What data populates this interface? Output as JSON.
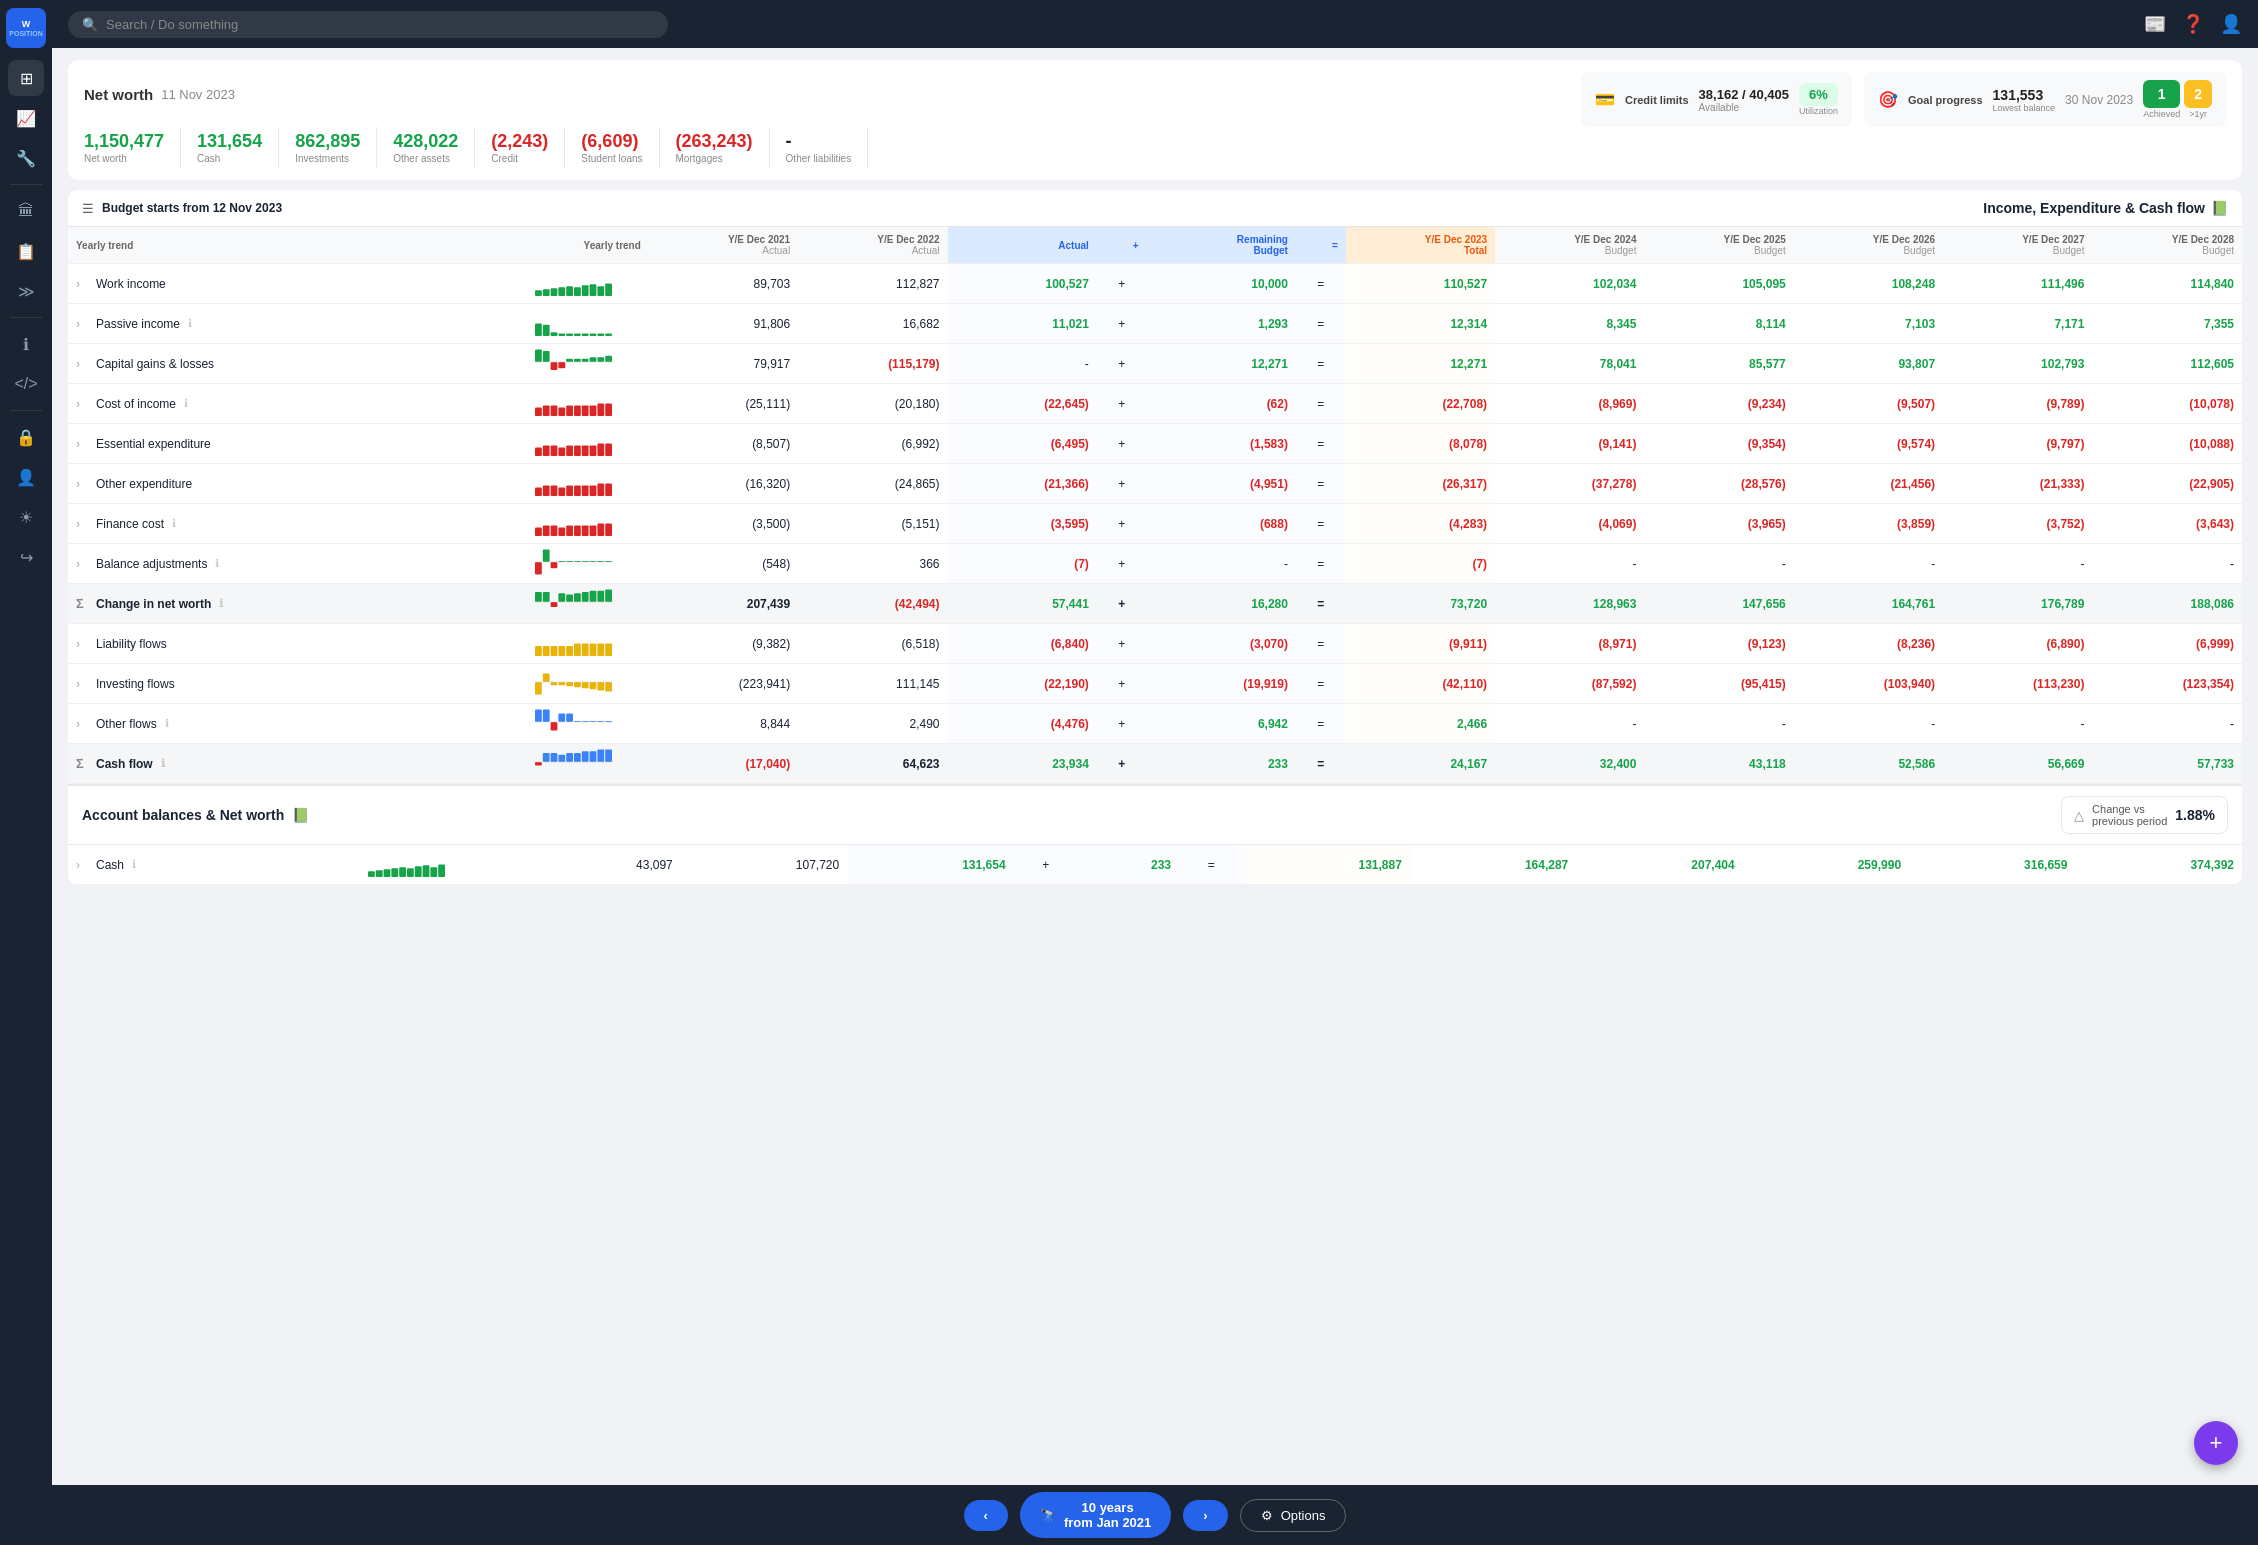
{
  "app": {
    "name": "Wealth Position",
    "search_placeholder": "Search / Do something"
  },
  "sidebar": {
    "items": [
      {
        "id": "dashboard",
        "icon": "⊞",
        "label": "Dashboard"
      },
      {
        "id": "trend",
        "icon": "📈",
        "label": "Trend"
      },
      {
        "id": "tools",
        "icon": "🔧",
        "label": "Tools"
      },
      {
        "id": "bank",
        "icon": "🏦",
        "label": "Bank"
      },
      {
        "id": "reports",
        "icon": "📋",
        "label": "Reports"
      },
      {
        "id": "expand",
        "icon": "≫",
        "label": "Expand"
      },
      {
        "id": "info",
        "icon": "ℹ",
        "label": "Info"
      },
      {
        "id": "code",
        "icon": "</>",
        "label": "Code"
      },
      {
        "id": "lock",
        "icon": "🔒",
        "label": "Lock"
      },
      {
        "id": "person",
        "icon": "👤",
        "label": "Person"
      },
      {
        "id": "settings",
        "icon": "☀",
        "label": "Settings"
      },
      {
        "id": "logout",
        "icon": "↪",
        "label": "Logout"
      }
    ]
  },
  "networth": {
    "title": "Net worth",
    "date": "11 Nov 2023",
    "metrics": [
      {
        "label": "Net worth",
        "value": "1,150,477",
        "color": "green"
      },
      {
        "label": "Cash",
        "value": "131,654",
        "color": "green"
      },
      {
        "label": "Investments",
        "value": "862,895",
        "color": "green"
      },
      {
        "label": "Other assets",
        "value": "428,022",
        "color": "green"
      },
      {
        "label": "Credit",
        "value": "(2,243)",
        "color": "red"
      },
      {
        "label": "Student loans",
        "value": "(6,609)",
        "color": "red"
      },
      {
        "label": "Mortgages",
        "value": "(263,243)",
        "color": "red"
      },
      {
        "label": "Other liabilities",
        "value": "-",
        "color": "dark"
      }
    ]
  },
  "credit": {
    "title": "Credit limits",
    "icon": "💳",
    "amount": "38,162 / 40,405",
    "available_label": "Available",
    "utilization": "6%",
    "util_label": "Utilization"
  },
  "goal": {
    "title": "Goal progress",
    "icon": "🎯",
    "balance": "131,553",
    "balance_label": "Lowest balance",
    "date": "30 Nov 2023",
    "achieved": "1",
    "achieved_label": "Achieved",
    "gt1yr": "2",
    "gt1yr_label": ">1yr"
  },
  "budget": {
    "header": "Budget starts from 12 Nov 2023",
    "period_label": "Yearly trend",
    "columns": [
      {
        "id": "trend",
        "label": "Yearly trend",
        "sub": ""
      },
      {
        "id": "y2021",
        "label": "Y/E Dec 2021",
        "sub": "Actual"
      },
      {
        "id": "y2022",
        "label": "Y/E Dec 2022",
        "sub": "Actual"
      },
      {
        "id": "actual",
        "label": "Actual",
        "sub": "",
        "highlight": "blue"
      },
      {
        "id": "plus",
        "label": "+",
        "sub": ""
      },
      {
        "id": "remaining",
        "label": "Remaining",
        "sub": "Budget"
      },
      {
        "id": "eq",
        "label": "=",
        "sub": ""
      },
      {
        "id": "y2023",
        "label": "Y/E Dec 2023",
        "sub": "Total",
        "highlight": "orange"
      },
      {
        "id": "y2024",
        "label": "Y/E Dec 2024",
        "sub": "Budget"
      },
      {
        "id": "y2025",
        "label": "Y/E Dec 2025",
        "sub": "Budget"
      },
      {
        "id": "y2026",
        "label": "Y/E Dec 2026",
        "sub": "Budget"
      },
      {
        "id": "y2027",
        "label": "Y/E Dec 2027",
        "sub": "Budget"
      },
      {
        "id": "y2028",
        "label": "Y/E Dec 2028",
        "sub": "Budget"
      }
    ],
    "section1": {
      "title": "Income, Expenditure & Cash flow",
      "rows": [
        {
          "id": "work-income",
          "label": "Work income",
          "type": "expandable",
          "has_info": false,
          "chart": "green-bars",
          "y2021": "89,703",
          "y2022": "112,827",
          "actual": "100,527",
          "plus": "+",
          "remaining": "10,000",
          "eq": "=",
          "y2023": "110,527",
          "y2024": "102,034",
          "y2025": "105,095",
          "y2026": "108,248",
          "y2027": "111,496",
          "y2028": "114,840",
          "actual_color": "green",
          "y2023_color": "green"
        },
        {
          "id": "passive-income",
          "label": "Passive income",
          "type": "expandable",
          "has_info": true,
          "chart": "green-small",
          "y2021": "91,806",
          "y2022": "16,682",
          "actual": "11,021",
          "plus": "+",
          "remaining": "1,293",
          "eq": "=",
          "y2023": "12,314",
          "y2024": "8,345",
          "y2025": "8,114",
          "y2026": "7,103",
          "y2027": "7,171",
          "y2028": "7,355",
          "actual_color": "green",
          "y2023_color": "green"
        },
        {
          "id": "capital-gains",
          "label": "Capital gains & losses",
          "type": "expandable",
          "has_info": false,
          "chart": "mixed",
          "y2021": "79,917",
          "y2022": "(115,179)",
          "actual": "-",
          "plus": "+",
          "remaining": "12,271",
          "eq": "=",
          "y2023": "12,271",
          "y2024": "78,041",
          "y2025": "85,577",
          "y2026": "93,807",
          "y2027": "102,793",
          "y2028": "112,605",
          "actual_color": "dark",
          "y2023_color": "green",
          "y2022_color": "red"
        },
        {
          "id": "cost-of-income",
          "label": "Cost of income",
          "type": "expandable",
          "has_info": true,
          "chart": "red-bars",
          "y2021": "(25,111)",
          "y2022": "(20,180)",
          "actual": "(22,645)",
          "plus": "+",
          "remaining": "(62)",
          "eq": "=",
          "y2023": "(22,708)",
          "y2024": "(8,969)",
          "y2025": "(9,234)",
          "y2026": "(9,507)",
          "y2027": "(9,789)",
          "y2028": "(10,078)",
          "actual_color": "red",
          "y2023_color": "red"
        },
        {
          "id": "essential-expenditure",
          "label": "Essential expenditure",
          "type": "expandable",
          "has_info": false,
          "chart": "red-bars",
          "y2021": "(8,507)",
          "y2022": "(6,992)",
          "actual": "(6,495)",
          "plus": "+",
          "remaining": "(1,583)",
          "eq": "=",
          "y2023": "(8,078)",
          "y2024": "(9,141)",
          "y2025": "(9,354)",
          "y2026": "(9,574)",
          "y2027": "(9,797)",
          "y2028": "(10,088)",
          "actual_color": "red",
          "y2023_color": "red"
        },
        {
          "id": "other-expenditure",
          "label": "Other expenditure",
          "type": "expandable",
          "has_info": false,
          "chart": "red-bars",
          "y2021": "(16,320)",
          "y2022": "(24,865)",
          "actual": "(21,366)",
          "plus": "+",
          "remaining": "(4,951)",
          "eq": "=",
          "y2023": "(26,317)",
          "y2024": "(37,278)",
          "y2025": "(28,576)",
          "y2026": "(21,456)",
          "y2027": "(21,333)",
          "y2028": "(22,905)",
          "actual_color": "red",
          "y2023_color": "red"
        },
        {
          "id": "finance-cost",
          "label": "Finance cost",
          "type": "expandable",
          "has_info": true,
          "chart": "red-bars",
          "y2021": "(3,500)",
          "y2022": "(5,151)",
          "actual": "(3,595)",
          "plus": "+",
          "remaining": "(688)",
          "eq": "=",
          "y2023": "(4,283)",
          "y2024": "(4,069)",
          "y2025": "(3,965)",
          "y2026": "(3,859)",
          "y2027": "(3,752)",
          "y2028": "(3,643)",
          "actual_color": "red",
          "y2023_color": "red"
        },
        {
          "id": "balance-adjustments",
          "label": "Balance adjustments",
          "type": "expandable",
          "has_info": true,
          "chart": "tiny-mixed",
          "y2021": "(548)",
          "y2022": "366",
          "actual": "(7)",
          "plus": "+",
          "remaining": "-",
          "eq": "=",
          "y2023": "(7)",
          "y2024": "-",
          "y2025": "-",
          "y2026": "-",
          "y2027": "-",
          "y2028": "-",
          "actual_color": "red",
          "y2023_color": "red"
        },
        {
          "id": "change-in-net-worth",
          "label": "Change in net worth",
          "type": "sigma",
          "has_info": true,
          "chart": "green-bars-tall",
          "y2021": "207,439",
          "y2022": "(42,494)",
          "actual": "57,441",
          "plus": "+",
          "remaining": "16,280",
          "eq": "=",
          "y2023": "73,720",
          "y2024": "128,963",
          "y2025": "147,656",
          "y2026": "164,761",
          "y2027": "176,789",
          "y2028": "188,086",
          "actual_color": "green",
          "y2022_color": "red",
          "y2023_color": "green",
          "is_sum": true
        },
        {
          "id": "liability-flows",
          "label": "Liability flows",
          "type": "expandable",
          "has_info": false,
          "chart": "yellow-bars",
          "y2021": "(9,382)",
          "y2022": "(6,518)",
          "actual": "(6,840)",
          "plus": "+",
          "remaining": "(3,070)",
          "eq": "=",
          "y2023": "(9,911)",
          "y2024": "(8,971)",
          "y2025": "(9,123)",
          "y2026": "(8,236)",
          "y2027": "(6,890)",
          "y2028": "(6,999)",
          "actual_color": "red",
          "y2023_color": "red"
        },
        {
          "id": "investing-flows",
          "label": "Investing flows",
          "type": "expandable",
          "has_info": false,
          "chart": "yellow-mixed",
          "y2021": "(223,941)",
          "y2022": "111,145",
          "actual": "(22,190)",
          "plus": "+",
          "remaining": "(19,919)",
          "eq": "=",
          "y2023": "(42,110)",
          "y2024": "(87,592)",
          "y2025": "(95,415)",
          "y2026": "(103,940)",
          "y2027": "(113,230)",
          "y2028": "(123,354)",
          "actual_color": "red",
          "y2023_color": "red"
        },
        {
          "id": "other-flows",
          "label": "Other flows",
          "type": "expandable",
          "has_info": true,
          "chart": "blue-bars",
          "y2021": "8,844",
          "y2022": "2,490",
          "actual": "(4,476)",
          "plus": "+",
          "remaining": "6,942",
          "eq": "=",
          "y2023": "2,466",
          "y2024": "-",
          "y2025": "-",
          "y2026": "-",
          "y2027": "-",
          "y2028": "-",
          "actual_color": "red",
          "y2023_color": "green"
        },
        {
          "id": "cash-flow",
          "label": "Cash flow",
          "type": "sigma",
          "has_info": true,
          "chart": "blue-mixed",
          "y2021": "(17,040)",
          "y2022": "64,623",
          "actual": "23,934",
          "plus": "+",
          "remaining": "233",
          "eq": "=",
          "y2023": "24,167",
          "y2024": "32,400",
          "y2025": "43,118",
          "y2026": "52,586",
          "y2027": "56,669",
          "y2028": "57,733",
          "actual_color": "green",
          "y2021_color": "red",
          "y2023_color": "green",
          "is_sum": true
        }
      ]
    },
    "section2": {
      "title": "Account balances & Net worth",
      "rows": [
        {
          "id": "cash",
          "label": "Cash",
          "type": "expandable",
          "has_info": true,
          "chart": "green-bars",
          "y2021": "43,097",
          "y2022": "107,720",
          "actual": "131,654",
          "plus": "+",
          "remaining": "233",
          "eq": "=",
          "y2023": "131,887",
          "y2024": "164,287",
          "y2025": "207,404",
          "y2026": "259,990",
          "y2027": "316,659",
          "y2028": "374,392",
          "actual_color": "green",
          "y2023_color": "green"
        }
      ]
    }
  },
  "bottom_nav": {
    "prev_label": "‹",
    "period_label": "10 years\nfrom Jan 2021",
    "next_label": "›",
    "binoculars": "🔭",
    "options_label": "Options",
    "options_icon": "⚙"
  },
  "change_vs_previous": {
    "label": "Change vs\nprevious period",
    "value": "1.88%"
  }
}
